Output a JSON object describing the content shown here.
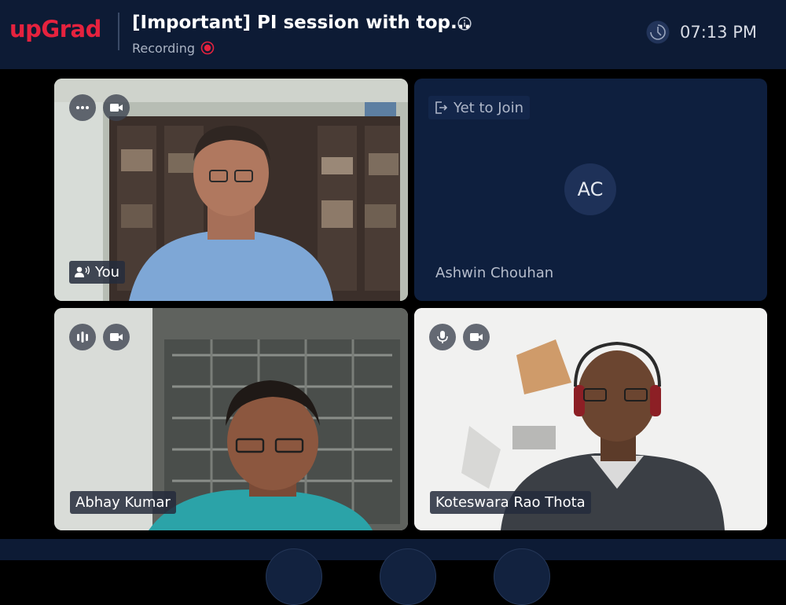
{
  "header": {
    "logo": "upGrad",
    "title": "[Important] PI session with top...",
    "recording_label": "Recording",
    "time": "07:13 PM"
  },
  "tiles": [
    {
      "name": "You",
      "video": "on"
    },
    {
      "name": "Ashwin Chouhan",
      "status": "Yet to Join",
      "initials": "AC"
    },
    {
      "name": "Abhay Kumar",
      "video": "on"
    },
    {
      "name": "Koteswara Rao Thota",
      "video": "on"
    }
  ],
  "colors": {
    "brand": "#e5223e",
    "header_bg": "#0d1b35",
    "tile_empty_bg": "#0e1f3e",
    "recording": "#e5223e"
  },
  "icons": [
    "info-icon",
    "recording-dot-icon",
    "clock-icon",
    "more-options-icon",
    "video-camera-icon",
    "speaking-icon",
    "audio-level-icon",
    "microphone-icon",
    "exit-icon"
  ]
}
